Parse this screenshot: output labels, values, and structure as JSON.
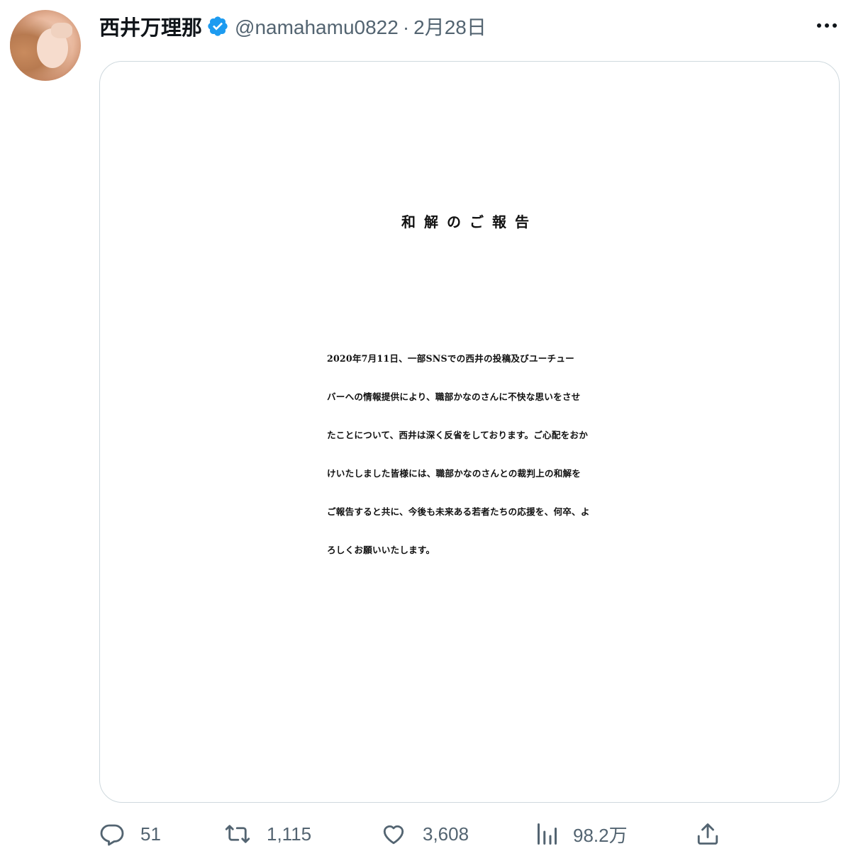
{
  "author": {
    "display_name": "西井万理那",
    "handle": "@namahamu0822",
    "separator": "·",
    "date": "2月28日",
    "verified": true
  },
  "media": {
    "title": "和解のご報告",
    "body_lines": [
      "2020年7月11日、一部SNSでの西井の投稿及びユーチュー",
      "バーへの情報提供により、職部かなのさんに不快な思いをさせ",
      "たことについて、西井は深く反省をしております。ご心配をおか",
      "けいたしました皆様には、職部かなのさんとの裁判上の和解を",
      "ご報告すると共に、今後も未来ある若者たちの応援を、何卒、よ",
      "ろしくお願いいたします。"
    ]
  },
  "actions": {
    "replies": "51",
    "retweets": "1,115",
    "likes": "3,608",
    "views": "98.2万"
  },
  "colors": {
    "verified_blue": "#1d9bf0",
    "meta_gray": "#536471",
    "border": "#cfd9de"
  },
  "icons": [
    "more-icon",
    "verified-badge-icon",
    "reply-icon",
    "retweet-icon",
    "like-icon",
    "views-icon",
    "share-icon"
  ]
}
